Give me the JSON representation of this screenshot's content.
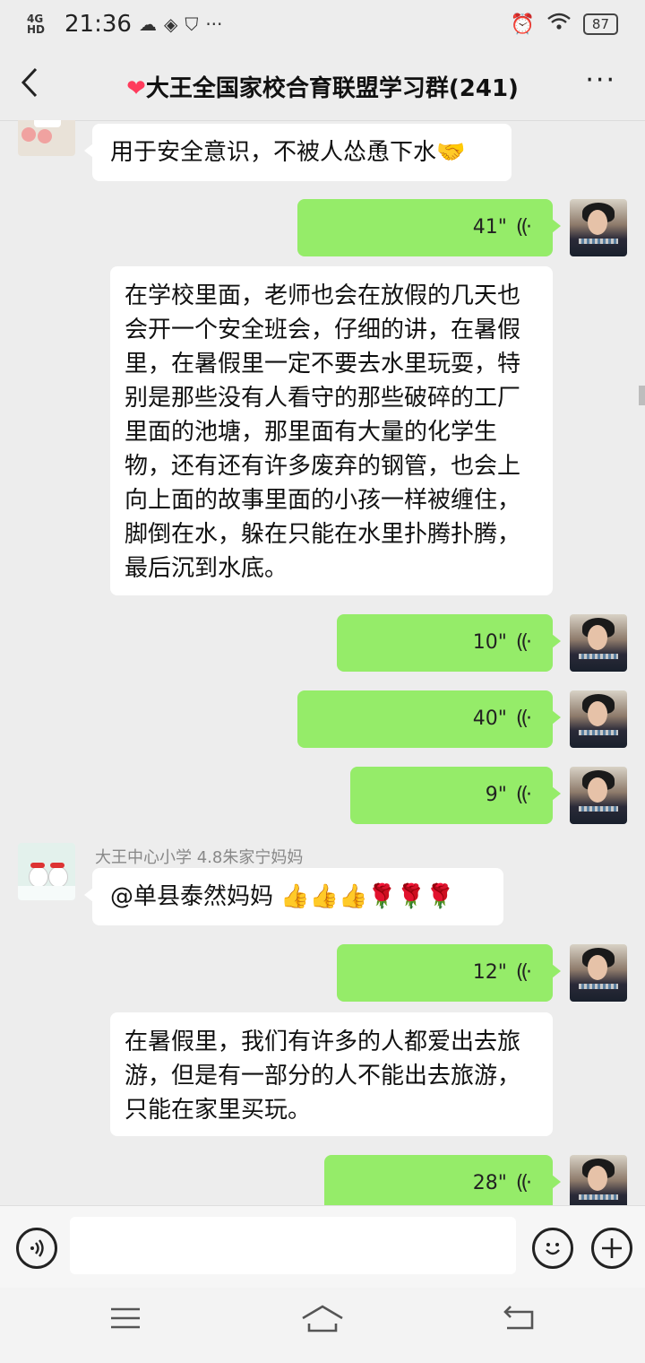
{
  "status_bar": {
    "network": "4G HD",
    "time": "21:36",
    "battery": "87"
  },
  "header": {
    "back_icon": "‹",
    "heart": "❤",
    "title": "大王全国家校合育联盟学习群(241)",
    "more": "···"
  },
  "messages": [
    {
      "type": "text",
      "side": "left",
      "text": "用于安全意识，不被人怂恿下水🤝"
    },
    {
      "type": "voice",
      "side": "right",
      "duration": "41\""
    },
    {
      "type": "text",
      "side": "right",
      "text": "在学校里面，老师也会在放假的几天也会开一个安全班会，仔细的讲，在暑假里，在暑假里一定不要去水里玩耍，特别是那些没有人看守的那些破碎的工厂里面的池塘，那里面有大量的化学生物，还有还有许多废弃的钢管，也会上向上面的故事里面的小孩一样被缠住，脚倒在水，躲在只能在水里扑腾扑腾，最后沉到水底。"
    },
    {
      "type": "voice",
      "side": "right",
      "duration": "10\""
    },
    {
      "type": "voice",
      "side": "right",
      "duration": "40\""
    },
    {
      "type": "voice",
      "side": "right",
      "duration": "9\""
    },
    {
      "type": "text",
      "side": "left",
      "sender": "大王中心小学 4.8朱家宁妈妈",
      "text": "@单县泰然妈妈 👍👍👍🌹🌹🌹"
    },
    {
      "type": "voice",
      "side": "right",
      "duration": "12\""
    },
    {
      "type": "text",
      "side": "right",
      "text": "在暑假里，我们有许多的人都爱出去旅游，但是有一部分的人不能出去旅游，只能在家里买玩。"
    },
    {
      "type": "voice",
      "side": "right",
      "duration": "28\""
    }
  ],
  "input_bar": {
    "voice_icon": "voice-toggle-icon",
    "emoji_icon": "emoji-icon",
    "plus_icon": "plus-icon"
  },
  "system_nav": {
    "menu": "☰",
    "home": "⌂",
    "back": "↩"
  }
}
